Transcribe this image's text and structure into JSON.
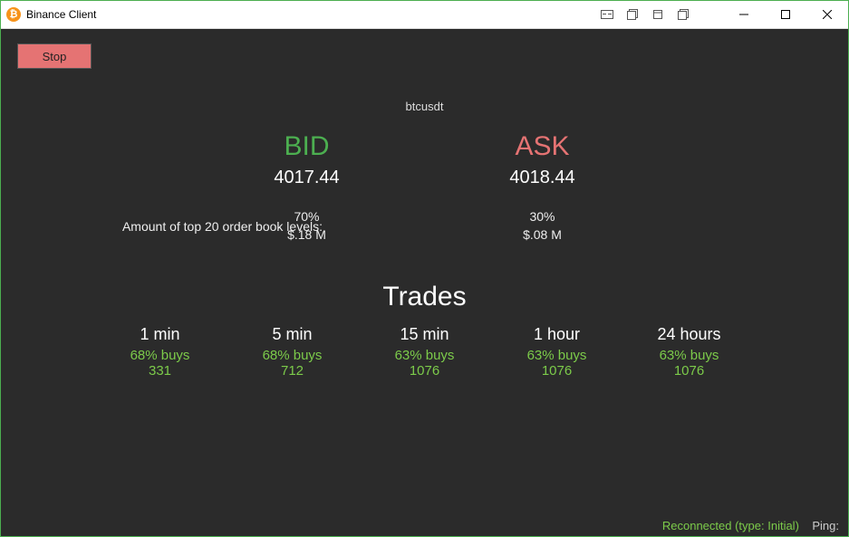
{
  "window": {
    "title": "Binance Client",
    "icon_glyph": "₿"
  },
  "controls": {
    "stop_label": "Stop"
  },
  "symbol": "btcusdt",
  "quotes": {
    "bid": {
      "label": "BID",
      "price": "4017.44"
    },
    "ask": {
      "label": "ASK",
      "price": "4018.44"
    }
  },
  "orderbook": {
    "label": "Amount of top 20 order book levels:",
    "bid": {
      "percent": "70%",
      "amount": "$.18 M"
    },
    "ask": {
      "percent": "30%",
      "amount": "$.08 M"
    }
  },
  "trades_section": {
    "title": "Trades",
    "columns": [
      {
        "period": "1 min",
        "buys": "68% buys",
        "count": "331"
      },
      {
        "period": "5 min",
        "buys": "68% buys",
        "count": "712"
      },
      {
        "period": "15 min",
        "buys": "63% buys",
        "count": "1076"
      },
      {
        "period": "1 hour",
        "buys": "63% buys",
        "count": "1076"
      },
      {
        "period": "24 hours",
        "buys": "63% buys",
        "count": "1076"
      }
    ]
  },
  "status": {
    "reconnected": "Reconnected (type: Initial)",
    "ping_label": "Ping:"
  }
}
